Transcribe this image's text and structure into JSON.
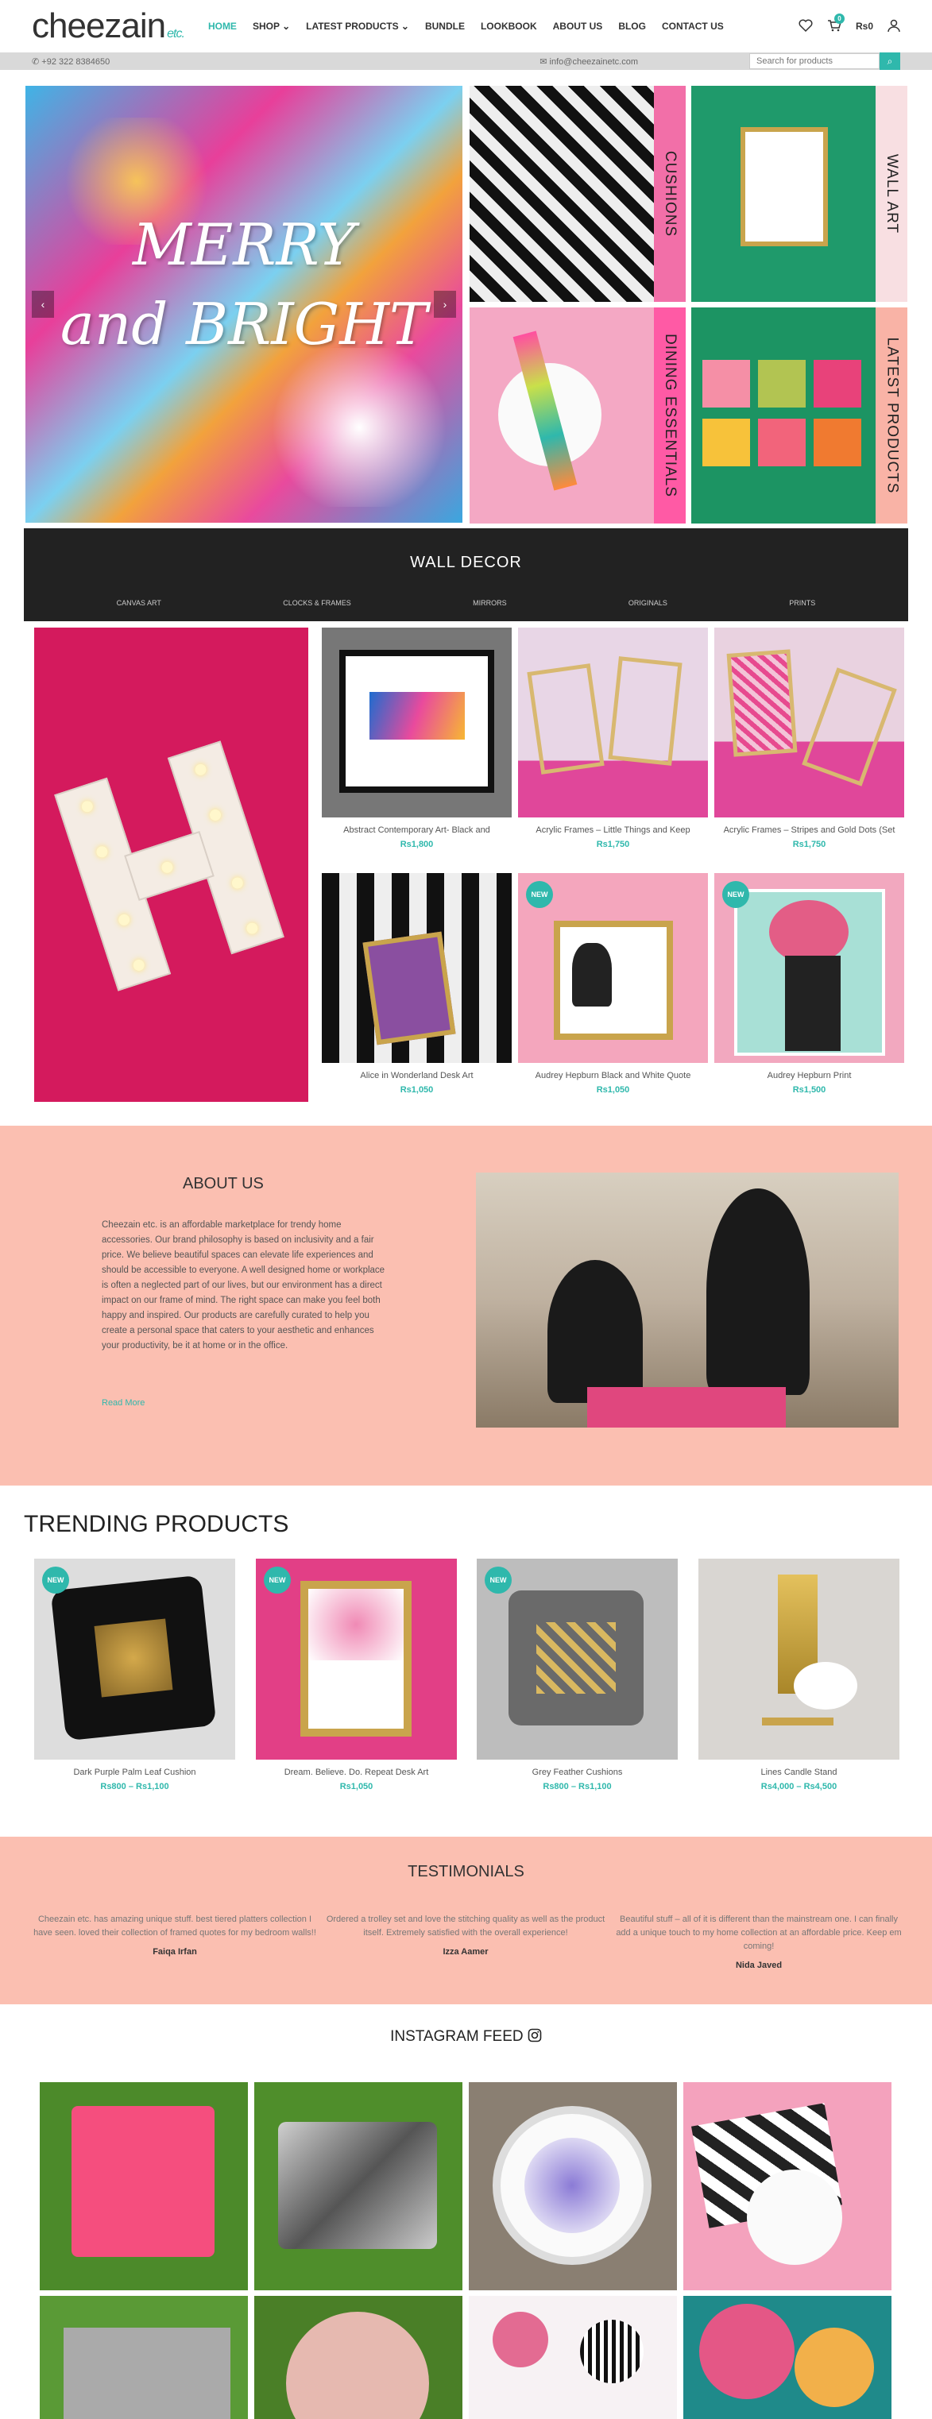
{
  "header": {
    "logo": "cheezain",
    "logo_suffix": "etc.",
    "nav": [
      "HOME",
      "SHOP",
      "LATEST PRODUCTS",
      "BUNDLE",
      "LOOKBOOK",
      "ABOUT US",
      "BLOG",
      "CONTACT US"
    ],
    "cart_count": "0",
    "cart_total": "Rs0"
  },
  "topbar": {
    "phone": "+92 322 8384650",
    "email": "info@cheezainetc.com",
    "search_placeholder": "Search for products"
  },
  "hero": {
    "slide_text_1": "MERRY",
    "slide_text_2": "and BRIGHT"
  },
  "tiles": {
    "cushions": "CUSHIONS",
    "wall_art": "WALL ART",
    "dining": "DINING ESSENTIALS",
    "latest": "LATEST PRODUCTS"
  },
  "wall_decor": {
    "title": "WALL DECOR",
    "categories": [
      "CANVAS ART",
      "CLOCKS & FRAMES",
      "MIRRORS",
      "ORIGINALS",
      "PRINTS"
    ]
  },
  "wall_products": [
    {
      "name": "Abstract Contemporary Art- Black and",
      "price": "Rs1,800",
      "new": ""
    },
    {
      "name": "Acrylic Frames – Little Things and Keep",
      "price": "Rs1,750",
      "new": ""
    },
    {
      "name": "Acrylic Frames – Stripes and Gold Dots (Set",
      "price": "Rs1,750",
      "new": ""
    },
    {
      "name": "Alice in Wonderland Desk Art",
      "price": "Rs1,050",
      "new": ""
    },
    {
      "name": "Audrey Hepburn Black and White Quote",
      "price": "Rs1,050",
      "new": "NEW"
    },
    {
      "name": "Audrey Hepburn Print",
      "price": "Rs1,500",
      "new": "NEW"
    }
  ],
  "about": {
    "title": "ABOUT US",
    "text": "Cheezain etc. is an affordable marketplace for trendy home accessories. Our brand philosophy is based on inclusivity and a fair price. We believe beautiful spaces can elevate life experiences and should be accessible to everyone. A well designed home or workplace is often a neglected part of our lives, but our environment has a direct impact on our frame of mind. The right space can make you feel both happy and inspired. Our products are carefully curated to help you create a personal space that caters to your aesthetic and enhances your productivity, be it at home or in the office.",
    "read_more": "Read More"
  },
  "trending": {
    "title": "TRENDING PRODUCTS",
    "items": [
      {
        "name": "Dark Purple Palm Leaf Cushion",
        "price": "Rs800 – Rs1,100",
        "new": "NEW"
      },
      {
        "name": "Dream. Believe. Do. Repeat Desk Art",
        "price": "Rs1,050",
        "new": "NEW"
      },
      {
        "name": "Grey Feather Cushions",
        "price": "Rs800 – Rs1,100",
        "new": "NEW"
      },
      {
        "name": "Lines Candle Stand",
        "price": "Rs4,000 – Rs4,500",
        "new": ""
      }
    ]
  },
  "testimonials": {
    "title": "TESTIMONIALS",
    "items": [
      {
        "text": "Cheezain etc. has amazing unique stuff. best tiered platters collection I have seen. loved their collection of framed quotes for my bedroom walls!!",
        "author": "Faiqa Irfan"
      },
      {
        "text": "Ordered a trolley set and love the stitching quality as well as the product itself. Extremely satisfied with the overall experience!",
        "author": "Izza Aamer"
      },
      {
        "text": "Beautiful stuff – all of it is different than the mainstream one. I can finally add a unique touch to my home collection at an affordable price. Keep em coming!",
        "author": "Nida Javed"
      }
    ]
  },
  "instagram": {
    "title": "INSTAGRAM FEED"
  },
  "colors": {
    "accent": "#2fb8ac",
    "peach": "#fbbfb1",
    "dark": "#222222"
  }
}
